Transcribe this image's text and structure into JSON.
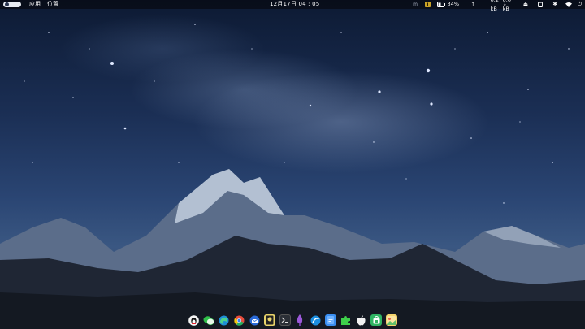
{
  "topbar": {
    "menu_apps": "应用",
    "menu_places": "位置",
    "clock": "12月17日 04 : 05",
    "tray": {
      "indicator_m": "m",
      "battery_percent": "34%",
      "upload_speed": "0.2 kB",
      "download_speed": "0.0 kB"
    }
  },
  "dock": {
    "apps": [
      {
        "name": "qq-icon"
      },
      {
        "name": "wechat-icon"
      },
      {
        "name": "edge-icon"
      },
      {
        "name": "chrome-icon"
      },
      {
        "name": "thunderbird-icon"
      },
      {
        "name": "media-player-icon"
      },
      {
        "name": "terminal-icon"
      },
      {
        "name": "ink-brush-icon"
      },
      {
        "name": "browser-blue-icon"
      },
      {
        "name": "notes-icon"
      },
      {
        "name": "extension-puzzle-icon"
      },
      {
        "name": "apple-icon"
      },
      {
        "name": "software-store-icon"
      },
      {
        "name": "photos-icon"
      }
    ]
  },
  "colors": {
    "topbar_bg": "#0a0e18",
    "sky_top": "#0d1a33",
    "sky_mid": "#2a4573"
  }
}
